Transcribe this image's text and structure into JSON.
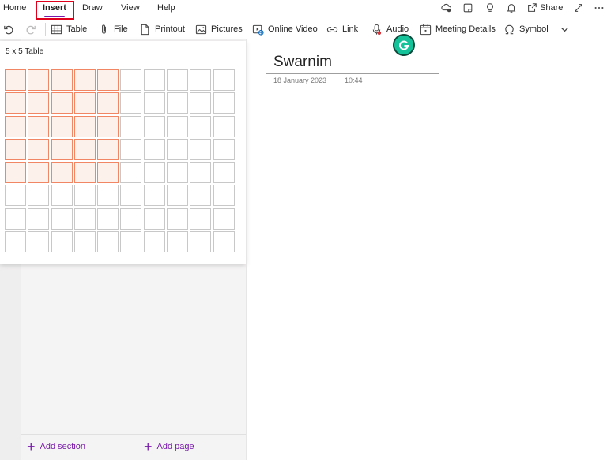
{
  "menu": {
    "tabs": [
      {
        "label": "Home"
      },
      {
        "label": "Insert"
      },
      {
        "label": "Draw"
      },
      {
        "label": "View"
      },
      {
        "label": "Help"
      }
    ],
    "share_label": "Share"
  },
  "ribbon": {
    "items": [
      {
        "label": "Table",
        "icon": "table-icon"
      },
      {
        "label": "File",
        "icon": "paperclip-icon"
      },
      {
        "label": "Printout",
        "icon": "document-icon"
      },
      {
        "label": "Pictures",
        "icon": "image-icon"
      },
      {
        "label": "Online Video",
        "icon": "video-icon"
      },
      {
        "label": "Link",
        "icon": "link-icon"
      },
      {
        "label": "Audio",
        "icon": "microphone-icon"
      },
      {
        "label": "Meeting Details",
        "icon": "calendar-icon"
      },
      {
        "label": "Symbol",
        "icon": "omega-icon"
      }
    ]
  },
  "table_picker": {
    "label": "5 x 5 Table",
    "selected_rows": 5,
    "selected_cols": 5
  },
  "navigation": {
    "add_section_label": "Add section",
    "add_page_label": "Add page"
  },
  "page": {
    "title": "Swarnim",
    "date": "18 January 2023",
    "time": "10:44"
  },
  "colors": {
    "accent": "#7719aa",
    "highlight_box": "#e0001b",
    "selected_cell": "#f08664",
    "grammarly": "#15c39a"
  }
}
